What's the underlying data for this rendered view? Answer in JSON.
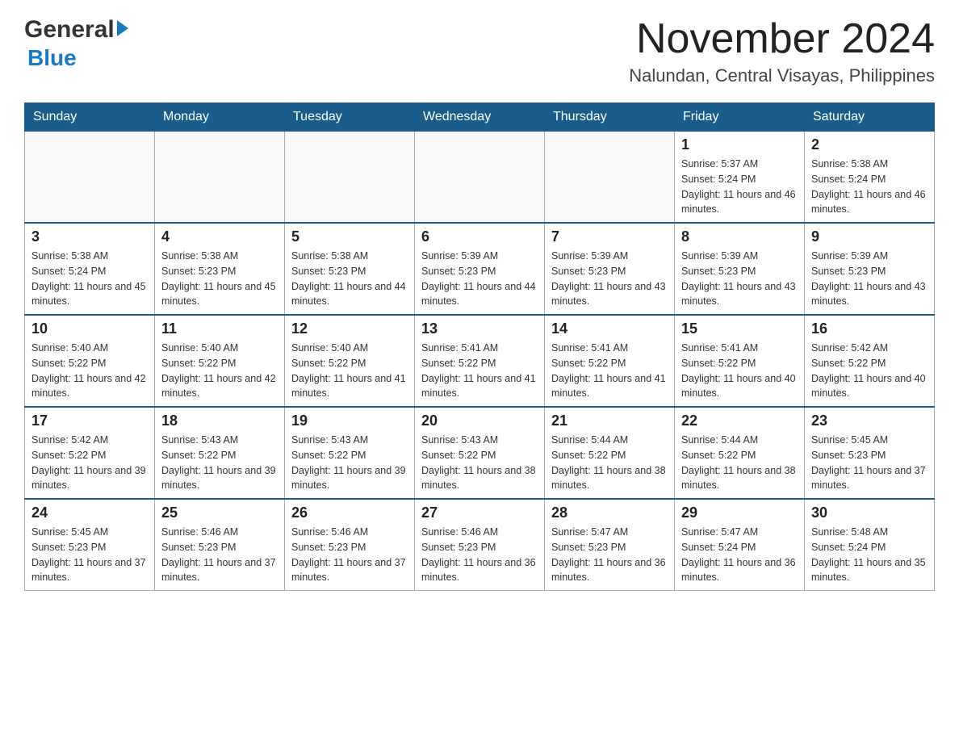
{
  "header": {
    "logo_general": "General",
    "logo_blue": "Blue",
    "month_title": "November 2024",
    "location": "Nalundan, Central Visayas, Philippines"
  },
  "calendar": {
    "days_of_week": [
      "Sunday",
      "Monday",
      "Tuesday",
      "Wednesday",
      "Thursday",
      "Friday",
      "Saturday"
    ],
    "weeks": [
      [
        {
          "day": "",
          "info": ""
        },
        {
          "day": "",
          "info": ""
        },
        {
          "day": "",
          "info": ""
        },
        {
          "day": "",
          "info": ""
        },
        {
          "day": "",
          "info": ""
        },
        {
          "day": "1",
          "info": "Sunrise: 5:37 AM\nSunset: 5:24 PM\nDaylight: 11 hours and 46 minutes."
        },
        {
          "day": "2",
          "info": "Sunrise: 5:38 AM\nSunset: 5:24 PM\nDaylight: 11 hours and 46 minutes."
        }
      ],
      [
        {
          "day": "3",
          "info": "Sunrise: 5:38 AM\nSunset: 5:24 PM\nDaylight: 11 hours and 45 minutes."
        },
        {
          "day": "4",
          "info": "Sunrise: 5:38 AM\nSunset: 5:23 PM\nDaylight: 11 hours and 45 minutes."
        },
        {
          "day": "5",
          "info": "Sunrise: 5:38 AM\nSunset: 5:23 PM\nDaylight: 11 hours and 44 minutes."
        },
        {
          "day": "6",
          "info": "Sunrise: 5:39 AM\nSunset: 5:23 PM\nDaylight: 11 hours and 44 minutes."
        },
        {
          "day": "7",
          "info": "Sunrise: 5:39 AM\nSunset: 5:23 PM\nDaylight: 11 hours and 43 minutes."
        },
        {
          "day": "8",
          "info": "Sunrise: 5:39 AM\nSunset: 5:23 PM\nDaylight: 11 hours and 43 minutes."
        },
        {
          "day": "9",
          "info": "Sunrise: 5:39 AM\nSunset: 5:23 PM\nDaylight: 11 hours and 43 minutes."
        }
      ],
      [
        {
          "day": "10",
          "info": "Sunrise: 5:40 AM\nSunset: 5:22 PM\nDaylight: 11 hours and 42 minutes."
        },
        {
          "day": "11",
          "info": "Sunrise: 5:40 AM\nSunset: 5:22 PM\nDaylight: 11 hours and 42 minutes."
        },
        {
          "day": "12",
          "info": "Sunrise: 5:40 AM\nSunset: 5:22 PM\nDaylight: 11 hours and 41 minutes."
        },
        {
          "day": "13",
          "info": "Sunrise: 5:41 AM\nSunset: 5:22 PM\nDaylight: 11 hours and 41 minutes."
        },
        {
          "day": "14",
          "info": "Sunrise: 5:41 AM\nSunset: 5:22 PM\nDaylight: 11 hours and 41 minutes."
        },
        {
          "day": "15",
          "info": "Sunrise: 5:41 AM\nSunset: 5:22 PM\nDaylight: 11 hours and 40 minutes."
        },
        {
          "day": "16",
          "info": "Sunrise: 5:42 AM\nSunset: 5:22 PM\nDaylight: 11 hours and 40 minutes."
        }
      ],
      [
        {
          "day": "17",
          "info": "Sunrise: 5:42 AM\nSunset: 5:22 PM\nDaylight: 11 hours and 39 minutes."
        },
        {
          "day": "18",
          "info": "Sunrise: 5:43 AM\nSunset: 5:22 PM\nDaylight: 11 hours and 39 minutes."
        },
        {
          "day": "19",
          "info": "Sunrise: 5:43 AM\nSunset: 5:22 PM\nDaylight: 11 hours and 39 minutes."
        },
        {
          "day": "20",
          "info": "Sunrise: 5:43 AM\nSunset: 5:22 PM\nDaylight: 11 hours and 38 minutes."
        },
        {
          "day": "21",
          "info": "Sunrise: 5:44 AM\nSunset: 5:22 PM\nDaylight: 11 hours and 38 minutes."
        },
        {
          "day": "22",
          "info": "Sunrise: 5:44 AM\nSunset: 5:22 PM\nDaylight: 11 hours and 38 minutes."
        },
        {
          "day": "23",
          "info": "Sunrise: 5:45 AM\nSunset: 5:23 PM\nDaylight: 11 hours and 37 minutes."
        }
      ],
      [
        {
          "day": "24",
          "info": "Sunrise: 5:45 AM\nSunset: 5:23 PM\nDaylight: 11 hours and 37 minutes."
        },
        {
          "day": "25",
          "info": "Sunrise: 5:46 AM\nSunset: 5:23 PM\nDaylight: 11 hours and 37 minutes."
        },
        {
          "day": "26",
          "info": "Sunrise: 5:46 AM\nSunset: 5:23 PM\nDaylight: 11 hours and 37 minutes."
        },
        {
          "day": "27",
          "info": "Sunrise: 5:46 AM\nSunset: 5:23 PM\nDaylight: 11 hours and 36 minutes."
        },
        {
          "day": "28",
          "info": "Sunrise: 5:47 AM\nSunset: 5:23 PM\nDaylight: 11 hours and 36 minutes."
        },
        {
          "day": "29",
          "info": "Sunrise: 5:47 AM\nSunset: 5:24 PM\nDaylight: 11 hours and 36 minutes."
        },
        {
          "day": "30",
          "info": "Sunrise: 5:48 AM\nSunset: 5:24 PM\nDaylight: 11 hours and 35 minutes."
        }
      ]
    ]
  }
}
